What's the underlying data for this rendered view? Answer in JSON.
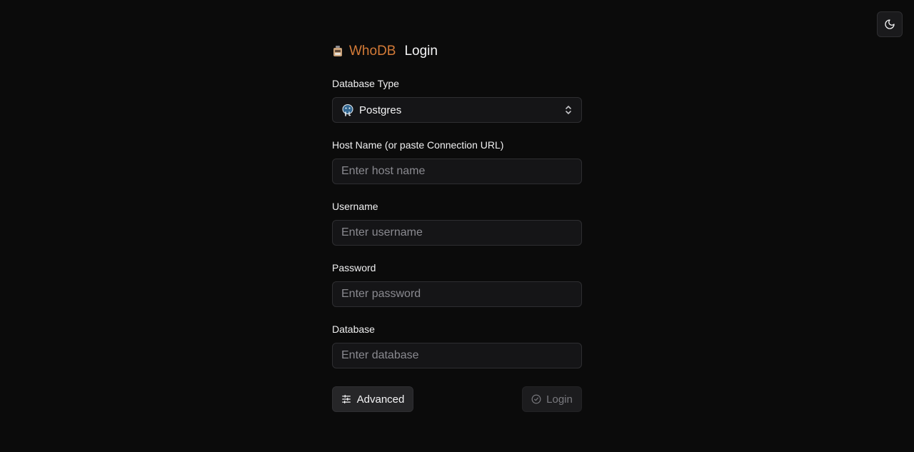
{
  "header": {
    "brand": "WhoDB",
    "title": "Login"
  },
  "theme_toggle": {
    "icon": "moon-icon"
  },
  "form": {
    "database_type": {
      "label": "Database Type",
      "value": "Postgres",
      "icon": "postgres-elephant-icon"
    },
    "host": {
      "label": "Host Name (or paste Connection URL)",
      "placeholder": "Enter host name",
      "value": ""
    },
    "username": {
      "label": "Username",
      "placeholder": "Enter username",
      "value": ""
    },
    "password": {
      "label": "Password",
      "placeholder": "Enter password",
      "value": ""
    },
    "database": {
      "label": "Database",
      "placeholder": "Enter database",
      "value": ""
    }
  },
  "actions": {
    "advanced_label": "Advanced",
    "login_label": "Login"
  },
  "colors": {
    "background": "#0b0b0b",
    "brand": "#d37a37",
    "input_bg": "#151517",
    "border": "#2e2e31",
    "muted_text": "#8a8a90"
  }
}
